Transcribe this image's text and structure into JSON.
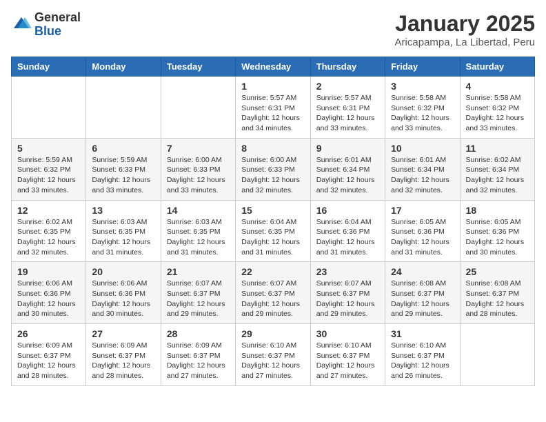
{
  "header": {
    "logo_general": "General",
    "logo_blue": "Blue",
    "month_title": "January 2025",
    "location": "Aricapampa, La Libertad, Peru"
  },
  "weekdays": [
    "Sunday",
    "Monday",
    "Tuesday",
    "Wednesday",
    "Thursday",
    "Friday",
    "Saturday"
  ],
  "weeks": [
    [
      {
        "day": "",
        "info": ""
      },
      {
        "day": "",
        "info": ""
      },
      {
        "day": "",
        "info": ""
      },
      {
        "day": "1",
        "info": "Sunrise: 5:57 AM\nSunset: 6:31 PM\nDaylight: 12 hours\nand 34 minutes."
      },
      {
        "day": "2",
        "info": "Sunrise: 5:57 AM\nSunset: 6:31 PM\nDaylight: 12 hours\nand 33 minutes."
      },
      {
        "day": "3",
        "info": "Sunrise: 5:58 AM\nSunset: 6:32 PM\nDaylight: 12 hours\nand 33 minutes."
      },
      {
        "day": "4",
        "info": "Sunrise: 5:58 AM\nSunset: 6:32 PM\nDaylight: 12 hours\nand 33 minutes."
      }
    ],
    [
      {
        "day": "5",
        "info": "Sunrise: 5:59 AM\nSunset: 6:32 PM\nDaylight: 12 hours\nand 33 minutes."
      },
      {
        "day": "6",
        "info": "Sunrise: 5:59 AM\nSunset: 6:33 PM\nDaylight: 12 hours\nand 33 minutes."
      },
      {
        "day": "7",
        "info": "Sunrise: 6:00 AM\nSunset: 6:33 PM\nDaylight: 12 hours\nand 33 minutes."
      },
      {
        "day": "8",
        "info": "Sunrise: 6:00 AM\nSunset: 6:33 PM\nDaylight: 12 hours\nand 32 minutes."
      },
      {
        "day": "9",
        "info": "Sunrise: 6:01 AM\nSunset: 6:34 PM\nDaylight: 12 hours\nand 32 minutes."
      },
      {
        "day": "10",
        "info": "Sunrise: 6:01 AM\nSunset: 6:34 PM\nDaylight: 12 hours\nand 32 minutes."
      },
      {
        "day": "11",
        "info": "Sunrise: 6:02 AM\nSunset: 6:34 PM\nDaylight: 12 hours\nand 32 minutes."
      }
    ],
    [
      {
        "day": "12",
        "info": "Sunrise: 6:02 AM\nSunset: 6:35 PM\nDaylight: 12 hours\nand 32 minutes."
      },
      {
        "day": "13",
        "info": "Sunrise: 6:03 AM\nSunset: 6:35 PM\nDaylight: 12 hours\nand 31 minutes."
      },
      {
        "day": "14",
        "info": "Sunrise: 6:03 AM\nSunset: 6:35 PM\nDaylight: 12 hours\nand 31 minutes."
      },
      {
        "day": "15",
        "info": "Sunrise: 6:04 AM\nSunset: 6:35 PM\nDaylight: 12 hours\nand 31 minutes."
      },
      {
        "day": "16",
        "info": "Sunrise: 6:04 AM\nSunset: 6:36 PM\nDaylight: 12 hours\nand 31 minutes."
      },
      {
        "day": "17",
        "info": "Sunrise: 6:05 AM\nSunset: 6:36 PM\nDaylight: 12 hours\nand 31 minutes."
      },
      {
        "day": "18",
        "info": "Sunrise: 6:05 AM\nSunset: 6:36 PM\nDaylight: 12 hours\nand 30 minutes."
      }
    ],
    [
      {
        "day": "19",
        "info": "Sunrise: 6:06 AM\nSunset: 6:36 PM\nDaylight: 12 hours\nand 30 minutes."
      },
      {
        "day": "20",
        "info": "Sunrise: 6:06 AM\nSunset: 6:36 PM\nDaylight: 12 hours\nand 30 minutes."
      },
      {
        "day": "21",
        "info": "Sunrise: 6:07 AM\nSunset: 6:37 PM\nDaylight: 12 hours\nand 29 minutes."
      },
      {
        "day": "22",
        "info": "Sunrise: 6:07 AM\nSunset: 6:37 PM\nDaylight: 12 hours\nand 29 minutes."
      },
      {
        "day": "23",
        "info": "Sunrise: 6:07 AM\nSunset: 6:37 PM\nDaylight: 12 hours\nand 29 minutes."
      },
      {
        "day": "24",
        "info": "Sunrise: 6:08 AM\nSunset: 6:37 PM\nDaylight: 12 hours\nand 29 minutes."
      },
      {
        "day": "25",
        "info": "Sunrise: 6:08 AM\nSunset: 6:37 PM\nDaylight: 12 hours\nand 28 minutes."
      }
    ],
    [
      {
        "day": "26",
        "info": "Sunrise: 6:09 AM\nSunset: 6:37 PM\nDaylight: 12 hours\nand 28 minutes."
      },
      {
        "day": "27",
        "info": "Sunrise: 6:09 AM\nSunset: 6:37 PM\nDaylight: 12 hours\nand 28 minutes."
      },
      {
        "day": "28",
        "info": "Sunrise: 6:09 AM\nSunset: 6:37 PM\nDaylight: 12 hours\nand 27 minutes."
      },
      {
        "day": "29",
        "info": "Sunrise: 6:10 AM\nSunset: 6:37 PM\nDaylight: 12 hours\nand 27 minutes."
      },
      {
        "day": "30",
        "info": "Sunrise: 6:10 AM\nSunset: 6:37 PM\nDaylight: 12 hours\nand 27 minutes."
      },
      {
        "day": "31",
        "info": "Sunrise: 6:10 AM\nSunset: 6:37 PM\nDaylight: 12 hours\nand 26 minutes."
      },
      {
        "day": "",
        "info": ""
      }
    ]
  ]
}
